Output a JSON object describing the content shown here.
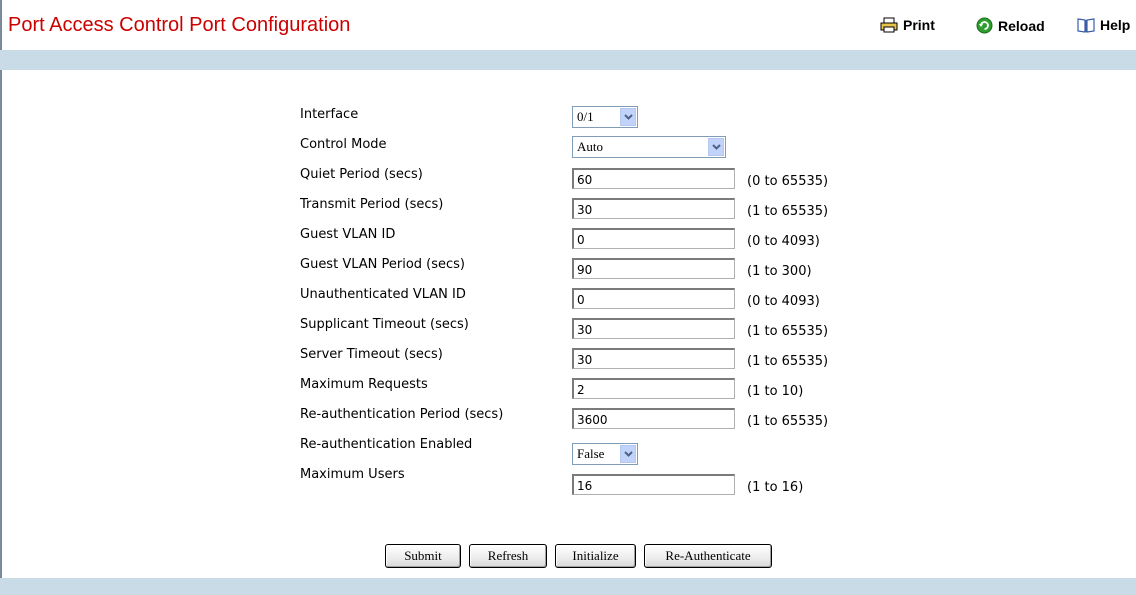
{
  "header": {
    "title": "Port Access Control Port Configuration",
    "print_label": "Print",
    "reload_label": "Reload",
    "help_label": "Help"
  },
  "form": {
    "interface": {
      "label": "Interface",
      "value": "0/1"
    },
    "control_mode": {
      "label": "Control Mode",
      "value": "Auto"
    },
    "quiet_period": {
      "label": "Quiet Period (secs)",
      "value": "60",
      "range": "(0 to 65535)"
    },
    "transmit_period": {
      "label": "Transmit Period (secs)",
      "value": "30",
      "range": "(1 to 65535)"
    },
    "guest_vlan_id": {
      "label": "Guest VLAN ID",
      "value": "0",
      "range": "(0 to 4093)"
    },
    "guest_vlan_period": {
      "label": "Guest VLAN Period (secs)",
      "value": "90",
      "range": "(1 to 300)"
    },
    "unauth_vlan_id": {
      "label": "Unauthenticated VLAN ID",
      "value": "0",
      "range": "(0 to 4093)"
    },
    "supplicant_timeout": {
      "label": "Supplicant Timeout (secs)",
      "value": "30",
      "range": "(1 to 65535)"
    },
    "server_timeout": {
      "label": "Server Timeout (secs)",
      "value": "30",
      "range": "(1 to 65535)"
    },
    "max_requests": {
      "label": "Maximum Requests",
      "value": "2",
      "range": "(1 to 10)"
    },
    "reauth_period": {
      "label": "Re-authentication Period (secs)",
      "value": "3600",
      "range": "(1 to 65535)"
    },
    "reauth_enabled": {
      "label": "Re-authentication Enabled",
      "value": "False"
    },
    "max_users": {
      "label": "Maximum Users",
      "value": "16",
      "range": "(1 to 16)"
    }
  },
  "buttons": {
    "submit": "Submit",
    "refresh": "Refresh",
    "initialize": "Initialize",
    "reauthenticate": "Re-Authenticate"
  },
  "colors": {
    "title": "#cc0000",
    "bar": "#c9dbe6"
  }
}
